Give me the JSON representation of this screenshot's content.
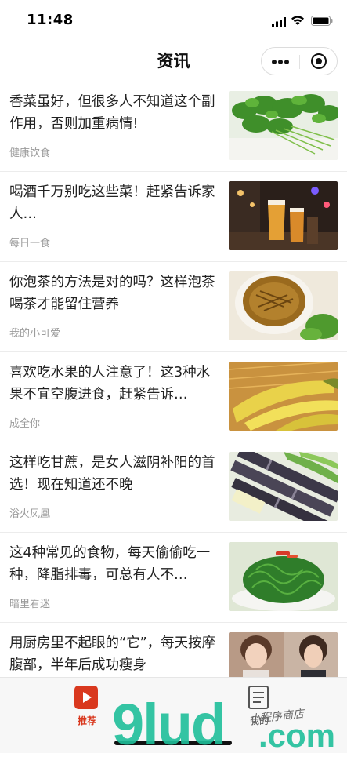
{
  "status_bar": {
    "time": "11:48",
    "icons": [
      "signal-icon",
      "wifi-icon",
      "battery-icon"
    ]
  },
  "header": {
    "title": "资讯",
    "capsule": [
      "more-icon",
      "close-icon"
    ]
  },
  "news": [
    {
      "title": "香菜虽好，但很多人不知道这个副作用，否则加重病情!",
      "source": "健康饮食",
      "thumb": "cilantro-image"
    },
    {
      "title": "喝酒千万别吃这些菜！赶紧告诉家人…",
      "source": "每日一食",
      "thumb": "beer-bar-image"
    },
    {
      "title": "你泡茶的方法是对的吗？这样泡茶喝茶才能留住营养",
      "source": "我的小可爱",
      "thumb": "tea-cup-image"
    },
    {
      "title": "喜欢吃水果的人注意了！这3种水果不宜空腹进食，赶紧告诉…",
      "source": "成全你",
      "thumb": "bananas-image"
    },
    {
      "title": "这样吃甘蔗，是女人滋阴补阳的首选！现在知道还不晚",
      "source": "浴火凤凰",
      "thumb": "sugarcane-image"
    },
    {
      "title": "这4种常见的食物，每天偷偷吃一种，降脂排毒，可总有人不…",
      "source": "暗里看迷",
      "thumb": "seaweed-salad-image"
    },
    {
      "title": "用厨房里不起眼的“它”，每天按摩腹部，半年后成功瘦身",
      "source": "",
      "thumb": "women-photo-image"
    }
  ],
  "tabbar": {
    "recommend_label": "推荐",
    "mine_label": "我的"
  },
  "watermark": {
    "logo": "9lud",
    "com": ".com",
    "caption": "小程序商店"
  },
  "colors": {
    "accent": "#d9381e",
    "watermark": "#1fbf9a"
  }
}
